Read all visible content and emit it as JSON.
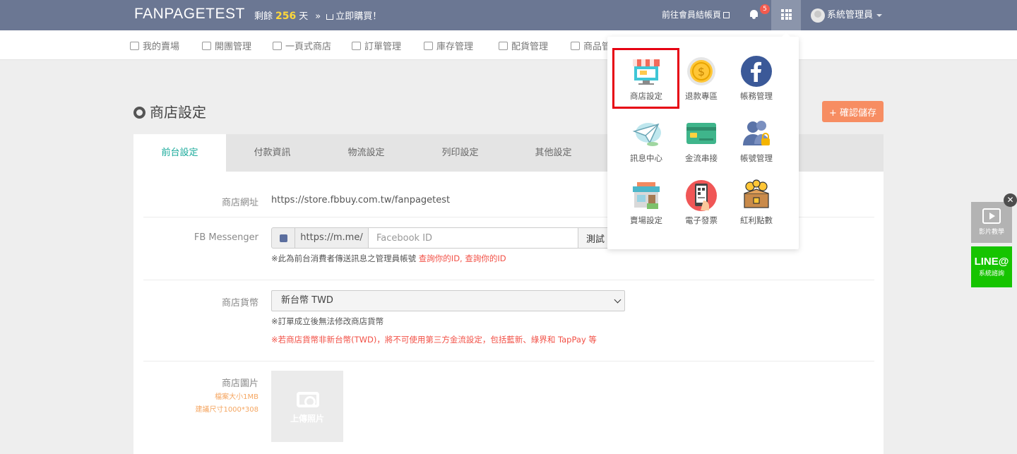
{
  "topbar": {
    "brand": "FANPAGETEST",
    "remain_prefix": "剩餘",
    "remain_days": "256",
    "remain_suffix": "天",
    "arrow": "»",
    "buy_now": "立即購買！",
    "member_link": "前往會員結帳頁",
    "notification_count": "5",
    "user_name": "系統管理員"
  },
  "subnav": {
    "items": [
      "我的賣場",
      "開團管理",
      "一頁式商店",
      "訂單管理",
      "庫存管理",
      "配貨管理",
      "商品管"
    ]
  },
  "page": {
    "title": "商店設定",
    "confirm_button": "確認儲存",
    "confirm_plus": "+"
  },
  "tabs": [
    "前台設定",
    "付款資訊",
    "物流設定",
    "列印設定",
    "其他設定"
  ],
  "form": {
    "store_url_label": "商店網址",
    "store_url_value": "https://store.fbbuy.com.tw/fanpagetest",
    "messenger_label": "FB Messenger",
    "messenger_prefix": "https://m.me/",
    "messenger_placeholder": "Facebook ID",
    "messenger_test_button": "測試",
    "messenger_note": "※此為前台消費者傳送訊息之管理員帳號",
    "messenger_note_link": "查詢你的ID, 查詢你的ID",
    "currency_label": "商店貨幣",
    "currency_value": "新台幣 TWD",
    "currency_note": "※訂單成立後無法修改商店貨幣",
    "currency_warning": "※若商店貨幣非新台幣(TWD)，將不可使用第三方金流設定，包括藍新、綠界和 TapPay 等",
    "image_label": "商店圖片",
    "image_size_note": "檔案大小1MB",
    "image_dim_note": "建議尺寸1000*308",
    "upload_text": "上傳照片"
  },
  "apps_menu": {
    "items": [
      {
        "label": "商店設定"
      },
      {
        "label": "退款專區"
      },
      {
        "label": "帳務管理"
      },
      {
        "label": "訊息中心"
      },
      {
        "label": "金流串接"
      },
      {
        "label": "帳號管理"
      },
      {
        "label": "賣場設定"
      },
      {
        "label": "電子發票"
      },
      {
        "label": "紅利點數"
      }
    ]
  },
  "floating": {
    "close": "✕",
    "video_label": "影片教學",
    "line_title": "LINE@",
    "line_sub": "系統諮詢"
  },
  "colors": {
    "topbar": "#6b7793",
    "accent_tab": "#1aaa9b",
    "confirm_button": "#f78d62",
    "highlight_border": "#e60012",
    "line_green": "#16c400"
  }
}
